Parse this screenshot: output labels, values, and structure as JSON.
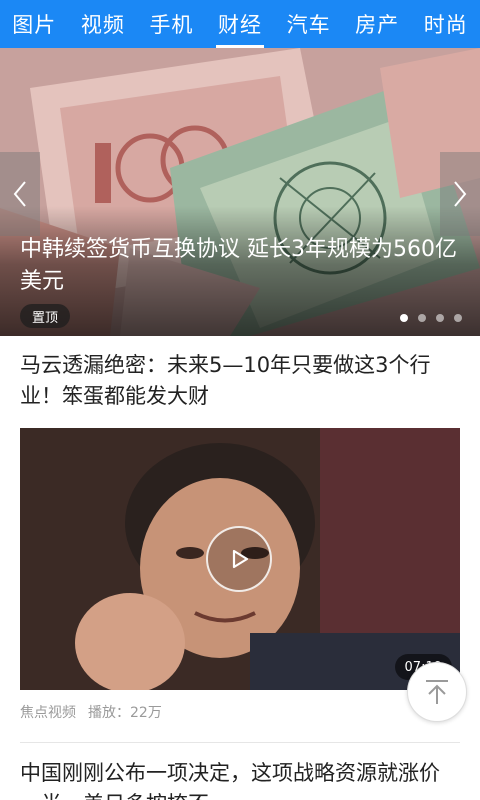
{
  "tabs": [
    {
      "label": "图片"
    },
    {
      "label": "视频"
    },
    {
      "label": "手机"
    },
    {
      "label": "财经",
      "active": true
    },
    {
      "label": "汽车"
    },
    {
      "label": "房产"
    },
    {
      "label": "时尚"
    }
  ],
  "colors": {
    "tab_bar": "#1b88f5",
    "text_primary": "#222222",
    "text_meta": "#9a9a9a"
  },
  "hero": {
    "title": "中韩续签货币互换协议 延长3年规模为560亿美元",
    "badge": "置顶",
    "slide_count": 4,
    "active_slide": 1,
    "prev_icon": "chevron-left-icon",
    "next_icon": "chevron-right-icon"
  },
  "article": {
    "title": "马云透漏绝密：未来5—10年只要做这3个行业！笨蛋都能发大财",
    "duration": "07:19",
    "source": "焦点视频",
    "plays": "播放：22万",
    "play_icon": "play-icon"
  },
  "next_article": {
    "title": "中国刚刚公布一项决定，这项战略资源就涨价一半，美日多按捺不"
  },
  "back_to_top_icon": "arrow-up-icon"
}
